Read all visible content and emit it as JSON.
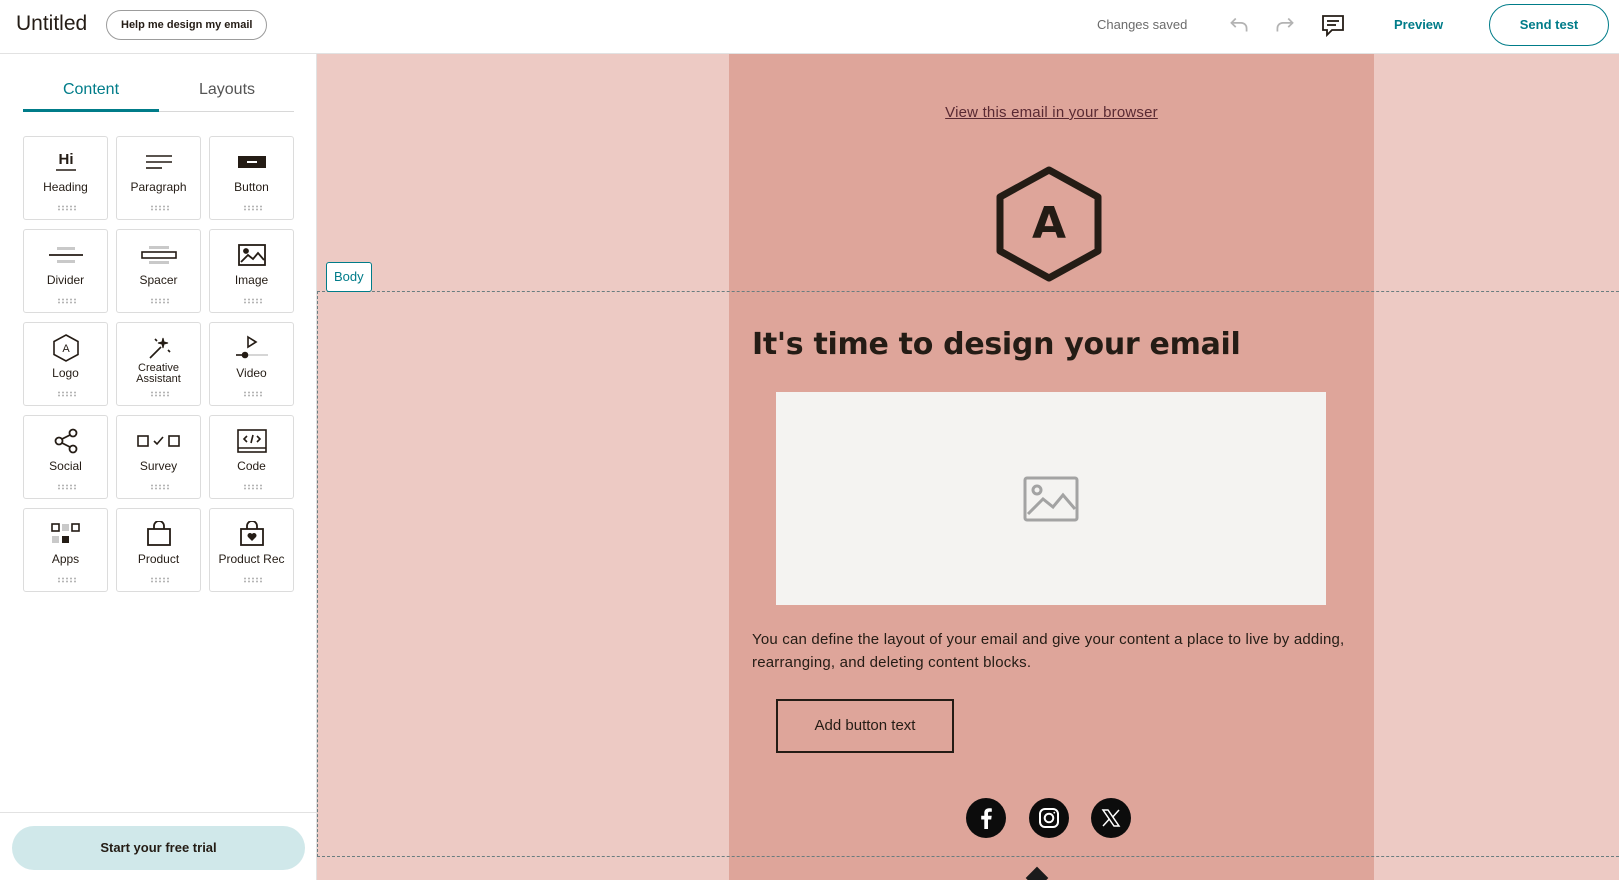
{
  "topbar": {
    "title": "Untitled",
    "help_label": "Help me design my email",
    "status": "Changes saved",
    "preview_label": "Preview",
    "send_test_label": "Send test",
    "icons": [
      "undo-icon",
      "redo-icon",
      "comment-icon"
    ]
  },
  "sidebar": {
    "tabs": [
      {
        "label": "Content",
        "active": true
      },
      {
        "label": "Layouts",
        "active": false
      }
    ],
    "blocks": [
      {
        "label": "Heading",
        "icon": "heading-icon"
      },
      {
        "label": "Paragraph",
        "icon": "paragraph-icon"
      },
      {
        "label": "Button",
        "icon": "button-icon"
      },
      {
        "label": "Divider",
        "icon": "divider-icon"
      },
      {
        "label": "Spacer",
        "icon": "spacer-icon"
      },
      {
        "label": "Image",
        "icon": "image-icon"
      },
      {
        "label": "Logo",
        "icon": "logo-icon"
      },
      {
        "label": "Creative Assistant",
        "icon": "magic-wand-icon"
      },
      {
        "label": "Video",
        "icon": "video-icon"
      },
      {
        "label": "Social",
        "icon": "share-icon"
      },
      {
        "label": "Survey",
        "icon": "survey-icon"
      },
      {
        "label": "Code",
        "icon": "code-icon"
      },
      {
        "label": "Apps",
        "icon": "apps-icon"
      },
      {
        "label": "Product",
        "icon": "shopping-bag-icon"
      },
      {
        "label": "Product Rec",
        "icon": "product-rec-icon"
      }
    ],
    "heading_icon_text": "Hi",
    "trial_label": "Start your free trial"
  },
  "canvas": {
    "body_tag": "Body",
    "view_in_browser": "View this email in your browser",
    "logo_letter": "A",
    "headline": "It's time to design your email",
    "body_text": "You can define the layout of your email and give your content a place to live by adding, rearranging, and deleting content blocks.",
    "button_text": "Add button text",
    "social_icons": [
      "facebook-icon",
      "instagram-icon",
      "x-icon"
    ]
  },
  "colors": {
    "accent": "#007c89",
    "canvas_bg": "#edcac4",
    "email_bg": "#dea59a",
    "trial_bg": "#d0e8ea"
  }
}
